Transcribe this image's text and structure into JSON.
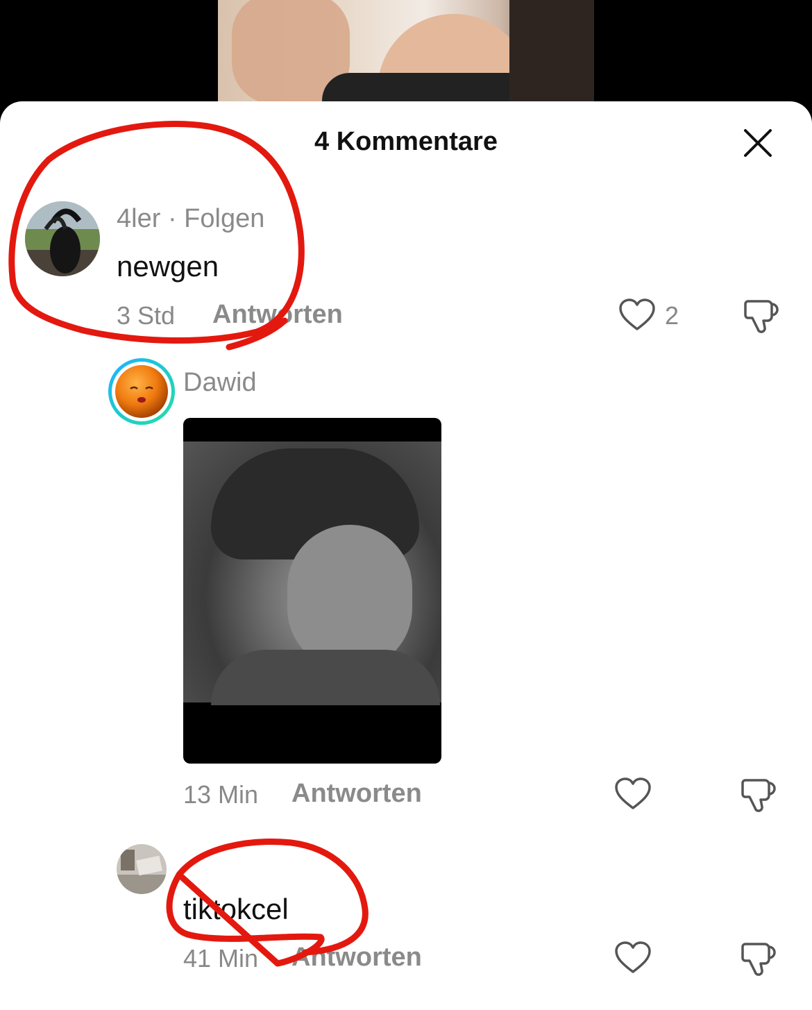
{
  "header": {
    "title": "4 Kommentare"
  },
  "comments": [
    {
      "user": "4ler",
      "follow_label": "· Folgen",
      "text": "newgen",
      "time": "3 Std",
      "reply_label": "Antworten",
      "like_count": "2"
    },
    {
      "user": "Dawid",
      "time": "13 Min",
      "reply_label": "Antworten"
    },
    {
      "text": "tiktokcel",
      "time": "41 Min",
      "reply_label": "Antworten"
    }
  ],
  "colors": {
    "annotation": "#e3190f",
    "story_ring_start": "#19b4ff",
    "story_ring_end": "#22e0a0"
  }
}
